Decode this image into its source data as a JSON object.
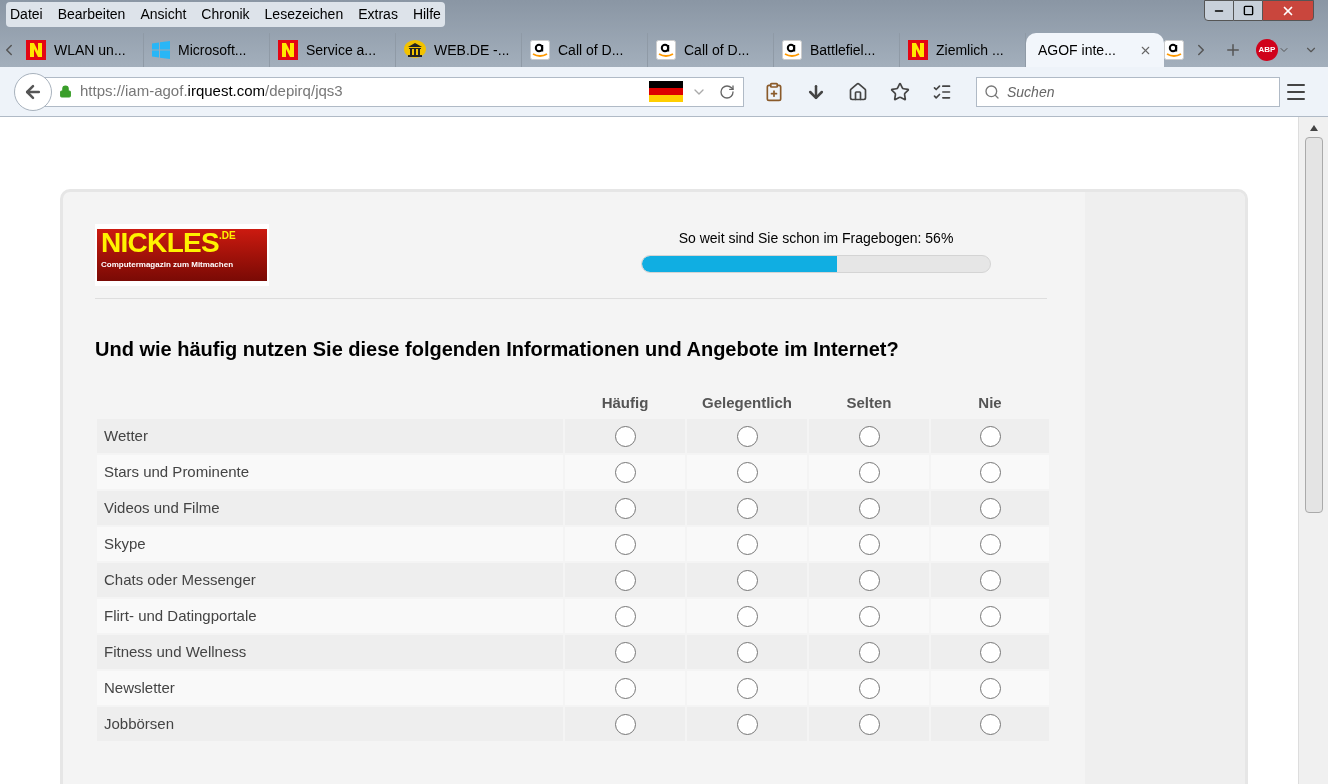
{
  "menu": [
    "Datei",
    "Bearbeiten",
    "Ansicht",
    "Chronik",
    "Lesezeichen",
    "Extras",
    "Hilfe"
  ],
  "tabs": [
    {
      "label": "WLAN un...",
      "kind": "n",
      "selected": false
    },
    {
      "label": "Microsoft...",
      "kind": "windows",
      "selected": false
    },
    {
      "label": "Service a...",
      "kind": "n",
      "selected": false
    },
    {
      "label": "WEB.DE -...",
      "kind": "webde",
      "selected": false
    },
    {
      "label": "Call of D...",
      "kind": "amazon",
      "selected": false
    },
    {
      "label": "Call of D...",
      "kind": "amazon",
      "selected": false
    },
    {
      "label": "Battlefiel...",
      "kind": "amazon",
      "selected": false
    },
    {
      "label": "Ziemlich ...",
      "kind": "n",
      "selected": false
    },
    {
      "label": "AGOF inte...",
      "kind": "plain",
      "selected": true
    },
    {
      "kind": "amazon",
      "selected": false
    }
  ],
  "abp_text": "ABP",
  "address": {
    "prefix": "https://iam-agof.",
    "domain": "irquest.com",
    "path": "/depirq/jqs3"
  },
  "search": {
    "placeholder": "Suchen"
  },
  "logo": {
    "name": "NICKLES",
    "suffix": ".DE",
    "tagline": "Computermagazin zum Mitmachen"
  },
  "progress": {
    "label": "So weit sind Sie schon im Fragebogen: 56%",
    "level": 0.56
  },
  "question": "Und wie häufig nutzen Sie diese folgenden Informationen und Angebote im Internet?",
  "columns": [
    "Häufig",
    "Gelegentlich",
    "Selten",
    "Nie"
  ],
  "rows": [
    {
      "label": "Wetter",
      "answer": null
    },
    {
      "label": "Stars und Prominente",
      "answer": null
    },
    {
      "label": "Videos und Filme",
      "answer": null
    },
    {
      "label": "Skype",
      "answer": null
    },
    {
      "label": "Chats oder Messenger",
      "answer": null
    },
    {
      "label": "Flirt- und Datingportale",
      "answer": null
    },
    {
      "label": "Fitness und Wellness",
      "answer": null
    },
    {
      "label": "Newsletter",
      "answer": null
    },
    {
      "label": "Jobbörsen",
      "answer": null
    }
  ]
}
